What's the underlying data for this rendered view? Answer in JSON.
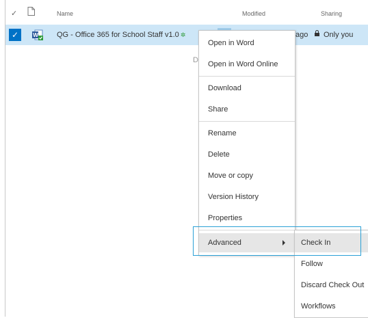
{
  "header": {
    "columns": {
      "check": "✓",
      "name": "Name",
      "modified": "Modified",
      "sharing": "Sharing"
    }
  },
  "row": {
    "checkmark": "✓",
    "name": "QG - Office 365 for School Staff v1.0",
    "name_tag": "✲",
    "modified": "ago",
    "sharing": "Only you"
  },
  "stray_text": "D",
  "context_menu": {
    "open_in_word": "Open in Word",
    "open_in_word_online": "Open in Word Online",
    "download": "Download",
    "share": "Share",
    "rename": "Rename",
    "delete": "Delete",
    "move_or_copy": "Move or copy",
    "version_history": "Version History",
    "properties": "Properties",
    "advanced": "Advanced"
  },
  "submenu": {
    "check_in": "Check In",
    "follow": "Follow",
    "discard_check_out": "Discard Check Out",
    "workflows": "Workflows"
  },
  "colors": {
    "selected_row": "#cde6f7",
    "accent": "#0072c6",
    "highlight_box": "#2aa0d6"
  }
}
